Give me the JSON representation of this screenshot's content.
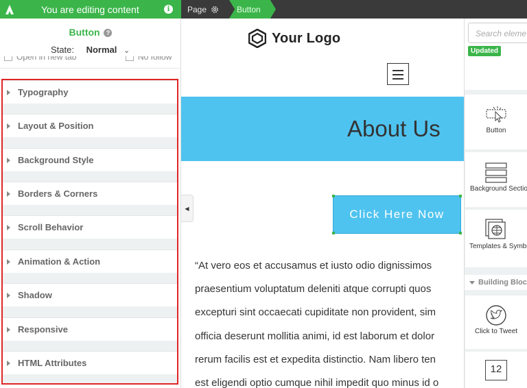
{
  "topbar": {
    "editing_label": "You are editing content",
    "info_icon": "i",
    "breadcrumb_page": "Page",
    "breadcrumb_current": "Button",
    "accent": "#3bb54a"
  },
  "left_panel": {
    "title": "Button",
    "help_icon": "?",
    "state_label": "State:",
    "state_value": "Normal",
    "open_new_tab_label": "Open in new tab",
    "no_follow_label": "No follow",
    "sections": [
      "Typography",
      "Layout & Position",
      "Background Style",
      "Borders & Corners",
      "Scroll Behavior",
      "Animation & Action",
      "Shadow",
      "Responsive",
      "HTML Attributes"
    ]
  },
  "canvas": {
    "logo_text": "Your Logo",
    "banner_title": "About Us",
    "banner_color": "#4fc3f0",
    "cta_label": "Click Here Now",
    "paragraph_lines": [
      "“At vero eos et accusamus et iusto odio dignissimos",
      "praesentium voluptatum deleniti atque corrupti quos",
      "excepturi sint occaecati cupiditate non provident, sim",
      "officia deserunt mollitia animi, id est laborum et dolor",
      "rerum facilis est et expedita distinctio. Nam libero ten",
      "est eligendi optio cumque nihil impedit quo minus id o"
    ]
  },
  "right_panel": {
    "search_placeholder": "Search eleme",
    "updated_badge": "Updated",
    "elements": [
      "Button",
      "Background Section",
      "Templates & Symbols"
    ],
    "building_blocks_header": "Building Blocks",
    "blocks": [
      "Click to Tweet",
      "12"
    ]
  }
}
